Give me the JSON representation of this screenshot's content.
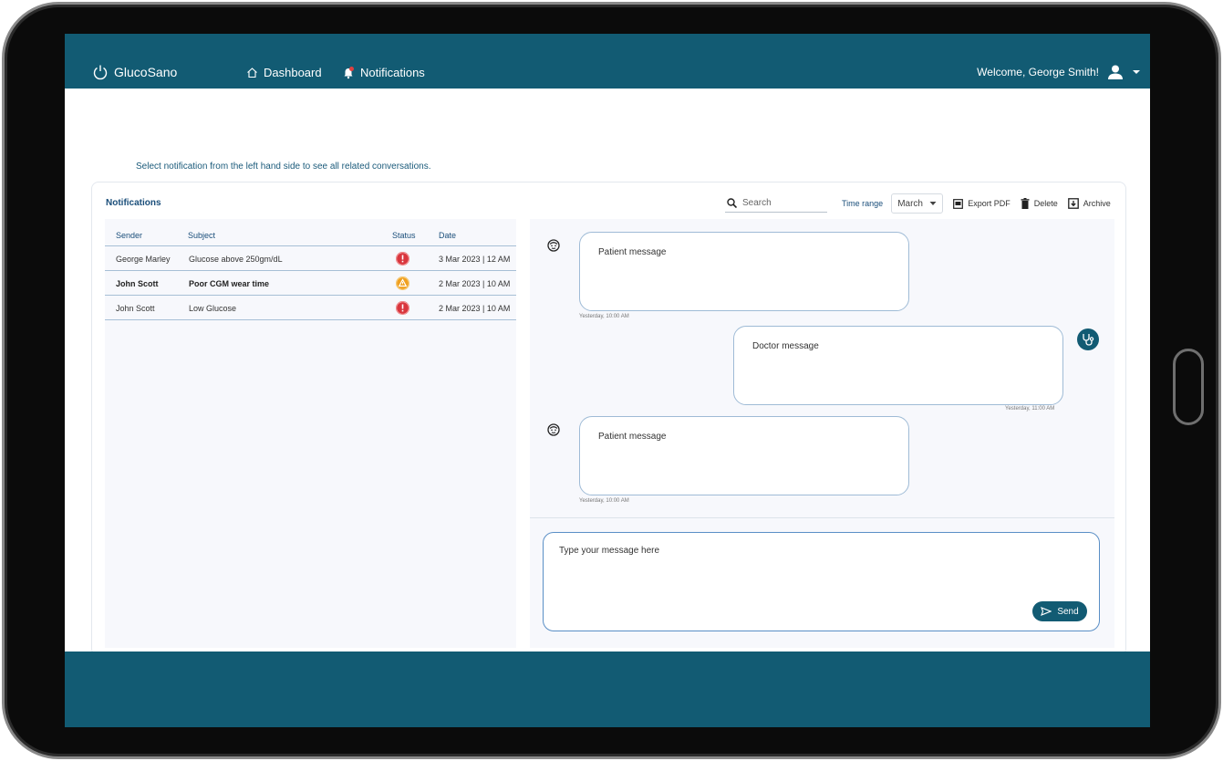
{
  "app": {
    "name": "GlucoSano",
    "brand_color": "#125b73"
  },
  "nav": {
    "dashboard_label": "Dashboard",
    "notifications_label": "Notifications",
    "welcome": "Welcome, George Smith!"
  },
  "hint": "Select notification from the left hand side to see all related conversations.",
  "panel": {
    "title": "Notifications",
    "search_placeholder": "Search",
    "time_range_label": "Time range",
    "time_range_value": "March",
    "export_label": "Export PDF",
    "delete_label": "Delete",
    "archive_label": "Archive"
  },
  "table": {
    "headers": {
      "sender": "Sender",
      "subject": "Subject",
      "status": "Status",
      "date": "Date"
    },
    "rows": [
      {
        "sender": "George Marley",
        "subject": "Glucose above 250gm/dL",
        "status": "critical",
        "date": "3 Mar 2023 | 12 AM",
        "bold": false
      },
      {
        "sender": "John Scott",
        "subject": "Poor CGM wear time",
        "status": "warning",
        "date": "2 Mar 2023 | 10 AM",
        "bold": true
      },
      {
        "sender": "John Scott",
        "subject": "Low Glucose",
        "status": "critical",
        "date": "2 Mar 2023 | 10 AM",
        "bold": false
      }
    ]
  },
  "messages": [
    {
      "from": "patient",
      "text": "Patient message",
      "time": "Yesterday, 10:00 AM"
    },
    {
      "from": "doctor",
      "text": "Doctor message",
      "time": "Yesterday, 11:00 AM"
    },
    {
      "from": "patient",
      "text": "Patient message",
      "time": "Yesterday, 10:00 AM"
    }
  ],
  "composer": {
    "placeholder": "Type your message here",
    "send_label": "Send"
  }
}
